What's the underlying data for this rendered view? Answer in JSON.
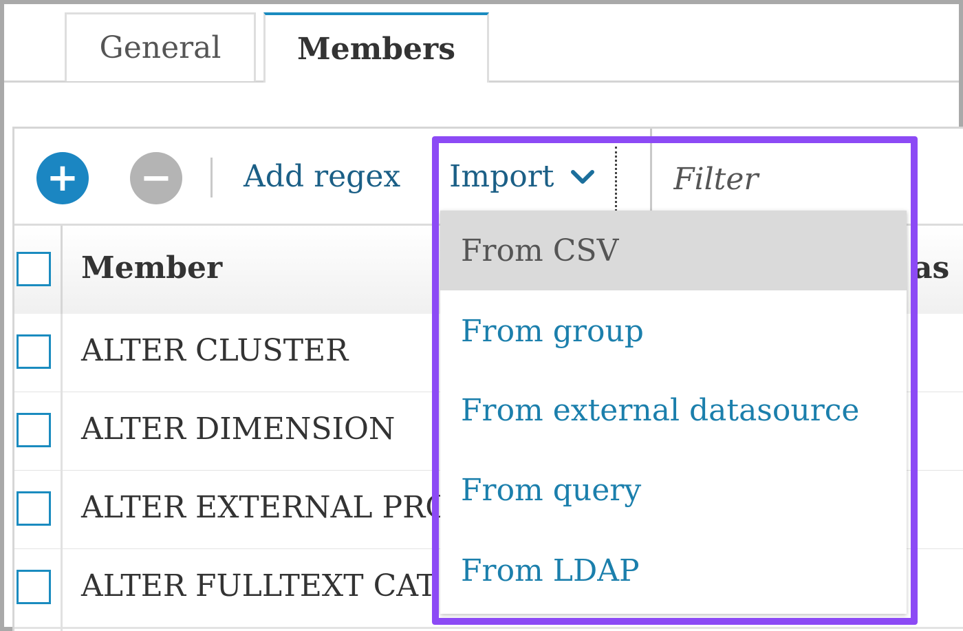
{
  "tabs": [
    {
      "label": "General"
    },
    {
      "label": "Members"
    }
  ],
  "toolbar": {
    "add_icon": "plus-circle-icon",
    "remove_icon": "minus-circle-icon",
    "add_regex_label": "Add regex",
    "import_label": "Import",
    "filter_placeholder": "Filter"
  },
  "table": {
    "columns": [
      "Member",
      "as"
    ],
    "rows": [
      {
        "member": "ALTER CLUSTER"
      },
      {
        "member": "ALTER DIMENSION"
      },
      {
        "member": "ALTER EXTERNAL PRO"
      },
      {
        "member": "ALTER FULLTEXT CAT"
      }
    ]
  },
  "import_menu": {
    "items": [
      {
        "label": "From CSV",
        "active": true
      },
      {
        "label": "From group"
      },
      {
        "label": "From external datasource"
      },
      {
        "label": "From query"
      },
      {
        "label": "From LDAP"
      }
    ]
  },
  "colors": {
    "accent": "#1b86c2",
    "link": "#1b7fac",
    "highlight": "#8c4af5"
  }
}
